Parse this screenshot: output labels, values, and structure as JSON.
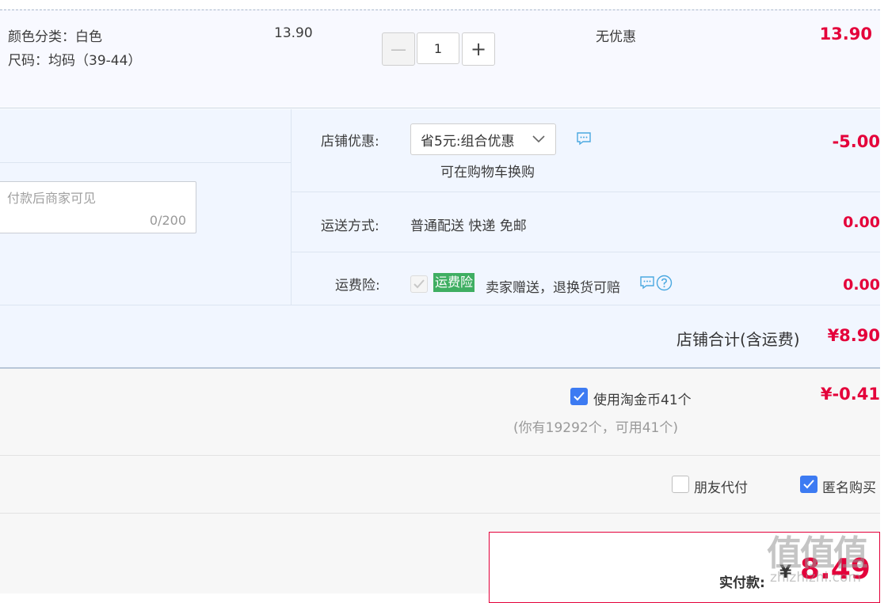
{
  "product": {
    "color_label": "颜色分类：白色",
    "size_label": "尺码：均码（39-44）",
    "unit_price": "13.90",
    "quantity": "1",
    "stepper_minus": "—",
    "stepper_plus": "+",
    "discount": "无优惠",
    "subtotal": "13.90"
  },
  "shop": {
    "memo_placeholder": "付款后商家可见",
    "memo_counter": "0/200",
    "promo_label": "店铺优惠:",
    "promo_selected": "省5元:组合优惠",
    "promo_note": "可在购物车换购",
    "promo_amount": "-5.00",
    "shipping_label": "运送方式:",
    "shipping_value": "普通配送 快递 免邮",
    "shipping_amount": "0.00",
    "insurance_label": "运费险:",
    "insurance_tag": "运费险",
    "insurance_desc": "卖家赠送，退换货可赔",
    "insurance_amount": "0.00",
    "total_label": "店铺合计(含运费)",
    "total_amount": "¥8.90"
  },
  "coins": {
    "use_label": "使用淘金币41个",
    "amount": "¥-0.41",
    "note": "(你有19292个，可用41个)"
  },
  "options": {
    "friend_pay_label": "朋友代付",
    "anonymous_label": "匿名购买"
  },
  "payment": {
    "label": "实付款:",
    "currency": "¥",
    "amount": "8.49"
  },
  "watermark": {
    "logo": "值值值",
    "domain": "zhizhizhi.com"
  },
  "colors": {
    "accent_red": "#e4003a",
    "checkbox_blue": "#3d7bf2",
    "insurance_green": "#3fae62"
  }
}
